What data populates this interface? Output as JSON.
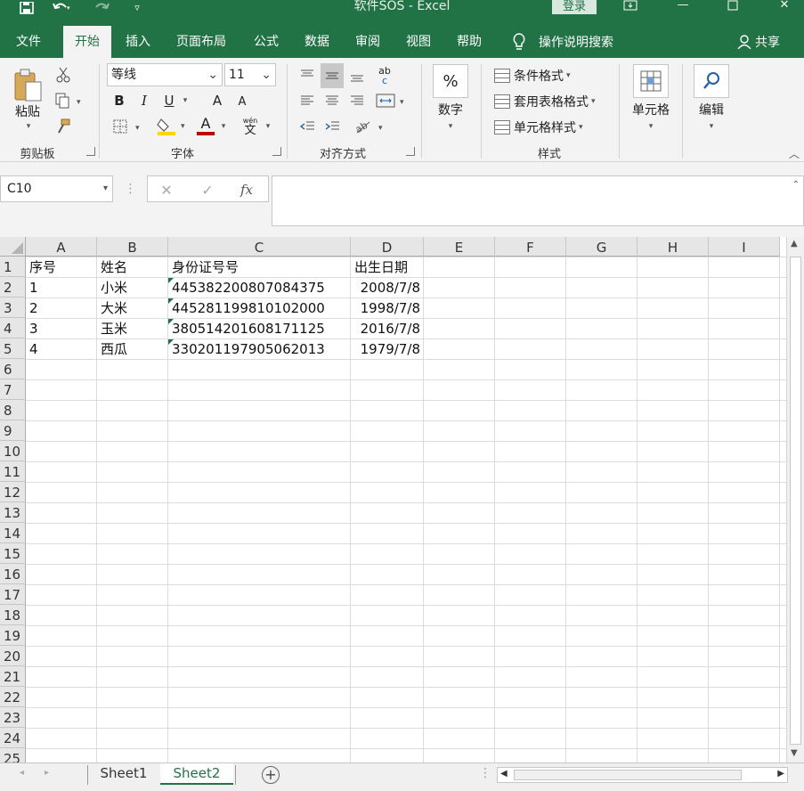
{
  "titlebar": {
    "title": "软件SOS  -  Excel",
    "login_label": "登录"
  },
  "tabs": [
    {
      "label": "文件"
    },
    {
      "label": "开始"
    },
    {
      "label": "插入"
    },
    {
      "label": "页面布局"
    },
    {
      "label": "公式"
    },
    {
      "label": "数据"
    },
    {
      "label": "审阅"
    },
    {
      "label": "视图"
    },
    {
      "label": "帮助"
    }
  ],
  "tell_me": "操作说明搜索",
  "share": "共享",
  "ribbon": {
    "clipboard": {
      "paste_label": "粘贴",
      "group_label": "剪贴板"
    },
    "font": {
      "font_name": "等线",
      "font_size": "11",
      "group_label": "字体",
      "bold": "B",
      "italic": "I",
      "underline": "U",
      "grow": "A",
      "shrink": "A",
      "font_color_letter": "A",
      "pinyin_top": "wén",
      "pinyin_bottom": "文"
    },
    "alignment": {
      "group_label": "对齐方式",
      "wrap_top": "ab",
      "wrap_bottom": "c"
    },
    "number": {
      "icon_text": "%",
      "label": "数字"
    },
    "styles": {
      "conditional": "条件格式",
      "table": "套用表格格式",
      "cell": "单元格样式",
      "group_label": "样式"
    },
    "cells": {
      "label": "单元格"
    },
    "editing": {
      "label": "编辑"
    }
  },
  "formula_bar": {
    "name_box": "C10",
    "cancel_symbol": "✕",
    "enter_symbol": "✓",
    "fx_symbol": "fx",
    "formula": ""
  },
  "grid": {
    "columns": [
      "A",
      "B",
      "C",
      "D",
      "E",
      "F",
      "G",
      "H",
      "I"
    ],
    "rows": [
      "1",
      "2",
      "3",
      "4",
      "5",
      "6",
      "7",
      "8",
      "9",
      "10",
      "11",
      "12",
      "13",
      "14",
      "15",
      "16",
      "17",
      "18",
      "19",
      "20",
      "21",
      "22",
      "23",
      "24",
      "25"
    ],
    "data": [
      [
        "序号",
        "姓名",
        "身份证号号",
        "出生日期"
      ],
      [
        "1",
        "小米",
        "445382200807084375",
        "2008/7/8"
      ],
      [
        "2",
        "大米",
        "445281199810102000",
        "1998/7/8"
      ],
      [
        "3",
        "玉米",
        "380514201608171125",
        "2016/7/8"
      ],
      [
        "4",
        "西瓜",
        "330201197905062013",
        "1979/7/8"
      ]
    ]
  },
  "sheets": [
    {
      "label": "Sheet1"
    },
    {
      "label": "Sheet2"
    }
  ],
  "colors": {
    "accent": "#217346",
    "error_marker": "#1e7145"
  }
}
